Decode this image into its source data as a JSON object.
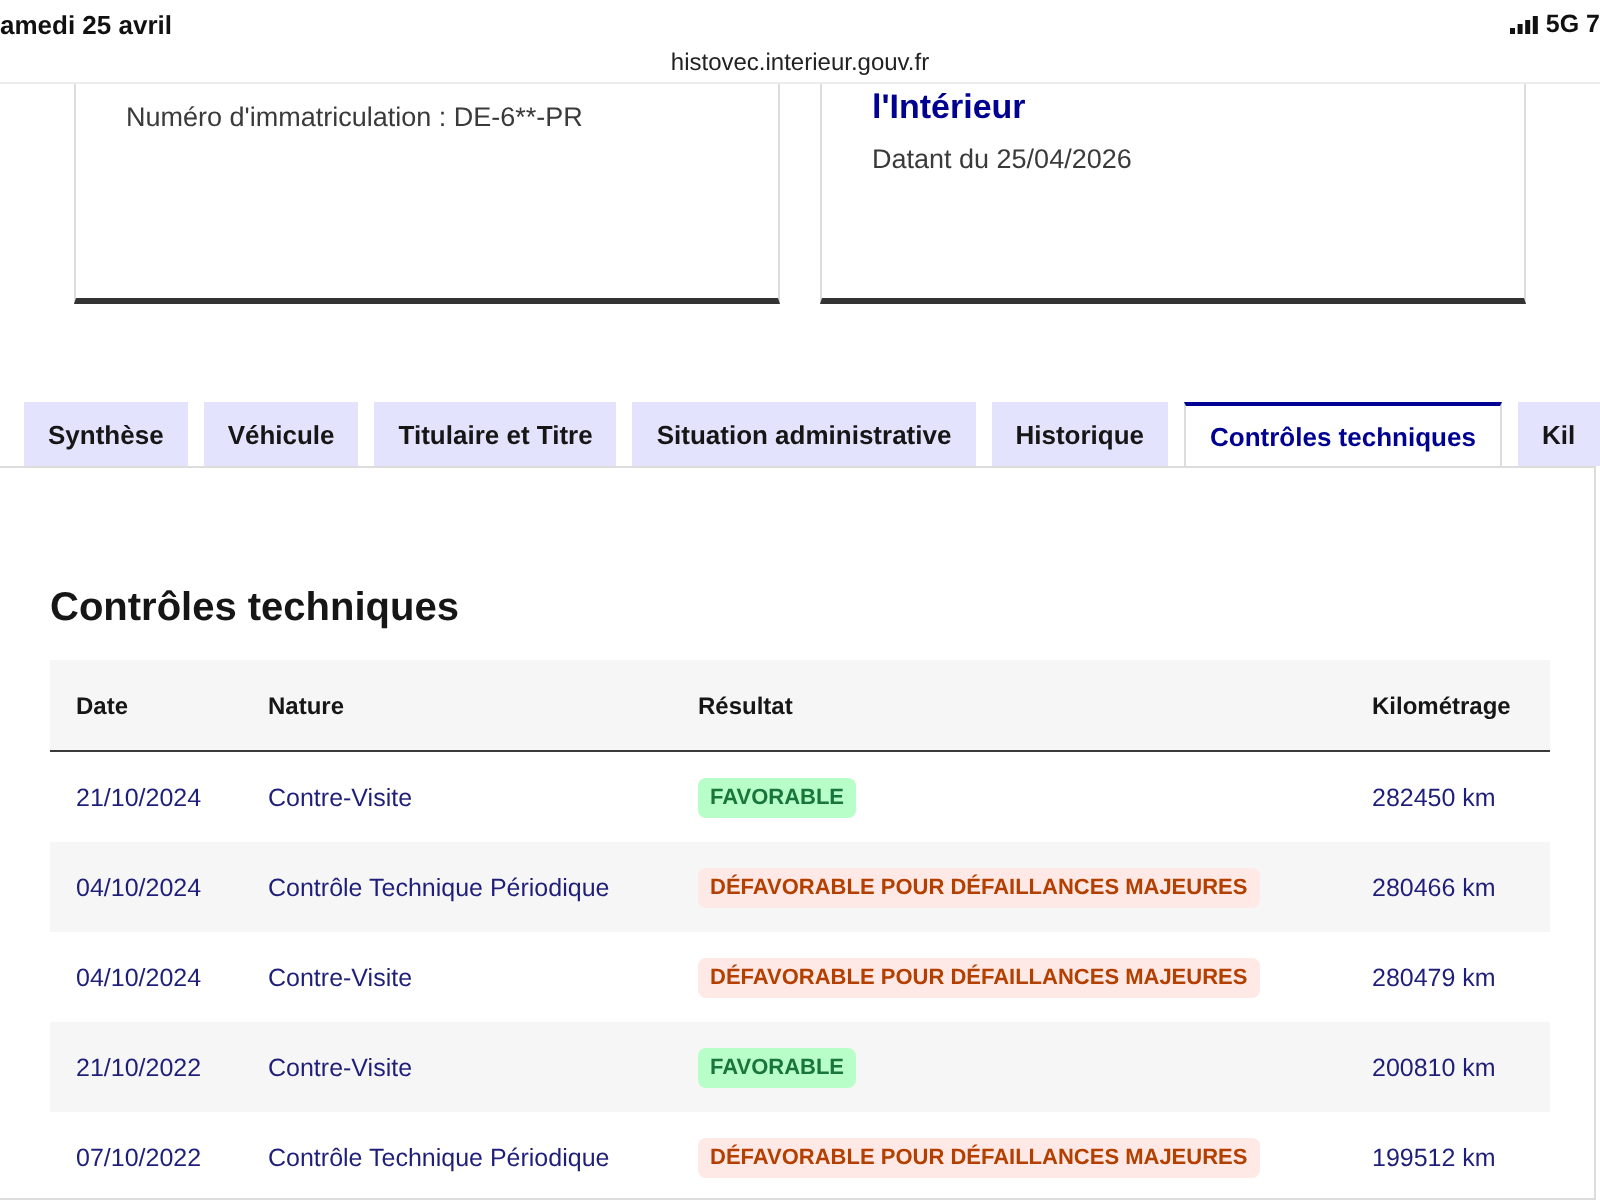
{
  "status_bar": {
    "date": "amedi 25 avril",
    "network": "5G 7"
  },
  "address_bar": {
    "url": "histovec.interieur.gouv.fr"
  },
  "cards": [
    {
      "text": "Numéro d'immatriculation : DE-6**-PR"
    },
    {
      "title": "l'Intérieur",
      "text": "Datant du 25/04/2026"
    }
  ],
  "tabs": [
    {
      "label": "Synthèse",
      "selected": false
    },
    {
      "label": "Véhicule",
      "selected": false
    },
    {
      "label": "Titulaire et Titre",
      "selected": false
    },
    {
      "label": "Situation administrative",
      "selected": false
    },
    {
      "label": "Historique",
      "selected": false
    },
    {
      "label": "Contrôles techniques",
      "selected": true
    },
    {
      "label": "Kil",
      "selected": false
    }
  ],
  "section": {
    "title": "Contrôles techniques",
    "table": {
      "columns": [
        "Date",
        "Nature",
        "Résultat",
        "Kilométrage"
      ],
      "rows": [
        {
          "date": "21/10/2024",
          "nature": "Contre-Visite",
          "result": {
            "label": "FAVORABLE",
            "kind": "success"
          },
          "mileage": "282450 km"
        },
        {
          "date": "04/10/2024",
          "nature": "Contrôle Technique Périodique",
          "result": {
            "label": "DÉFAVORABLE POUR DÉFAILLANCES MAJEURES",
            "kind": "error"
          },
          "mileage": "280466 km"
        },
        {
          "date": "04/10/2024",
          "nature": "Contre-Visite",
          "result": {
            "label": "DÉFAVORABLE POUR DÉFAILLANCES MAJEURES",
            "kind": "error"
          },
          "mileage": "280479 km"
        },
        {
          "date": "21/10/2022",
          "nature": "Contre-Visite",
          "result": {
            "label": "FAVORABLE",
            "kind": "success"
          },
          "mileage": "200810 km"
        },
        {
          "date": "07/10/2022",
          "nature": "Contrôle Technique Périodique",
          "result": {
            "label": "DÉFAVORABLE POUR DÉFAILLANCES MAJEURES",
            "kind": "error"
          },
          "mileage": "199512 km"
        }
      ]
    }
  }
}
